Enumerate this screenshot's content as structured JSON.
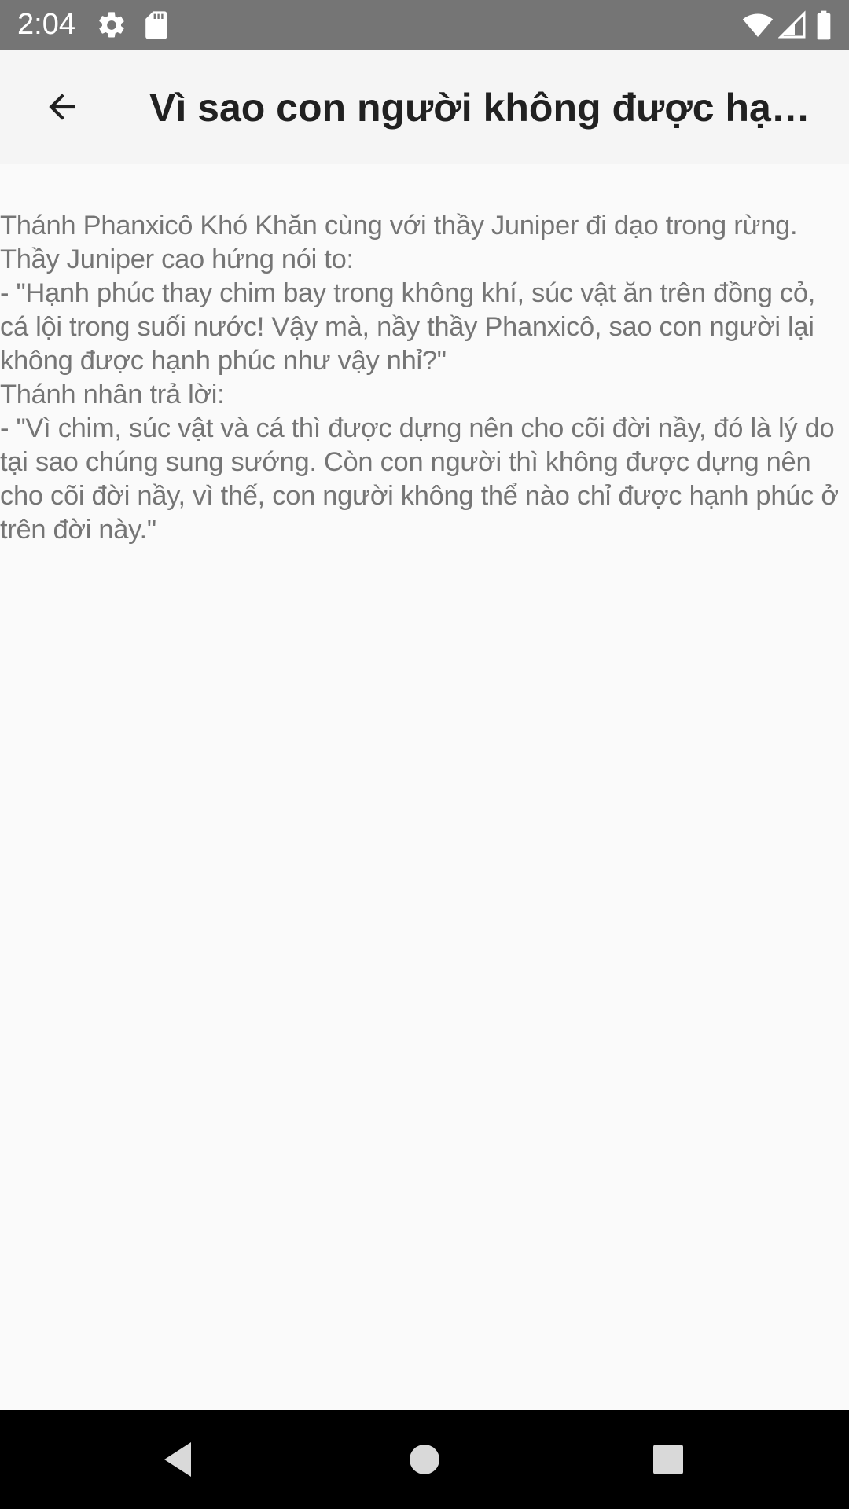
{
  "status_bar": {
    "time": "2:04",
    "icons": [
      "gear-icon",
      "sd-card-icon",
      "wifi-icon",
      "signal-icon",
      "battery-icon"
    ],
    "background": "#757575"
  },
  "app_bar": {
    "title": "Vì sao con người không được hạnh...",
    "back_icon": "arrow-back-icon",
    "background": "#f5f5f5"
  },
  "content": {
    "text": "Thánh Phanxicô Khó Khăn cùng với thầy Juniper đi dạo trong rừng.\nThầy Juniper cao hứng nói to:\n- \"Hạnh phúc thay chim bay trong không khí, súc vật ăn trên đồng cỏ, cá lội trong suối nước! Vậy mà, nầy thầy Phanxicô, sao con người lại không được hạnh phúc như vậy nhỉ?\"\nThánh nhân trả lời:\n- \"Vì chim, súc vật và cá thì được dựng nên cho cõi đời nầy, đó là lý do tại sao chúng sung sướng. Còn con người thì không được dựng nên cho cõi đời nầy, vì thế, con người không thể nào chỉ được hạnh phúc ở trên đời này.\"",
    "text_color": "#757575"
  },
  "nav_bar": {
    "icons": [
      "back-triangle-icon",
      "home-circle-icon",
      "recents-square-icon"
    ]
  }
}
